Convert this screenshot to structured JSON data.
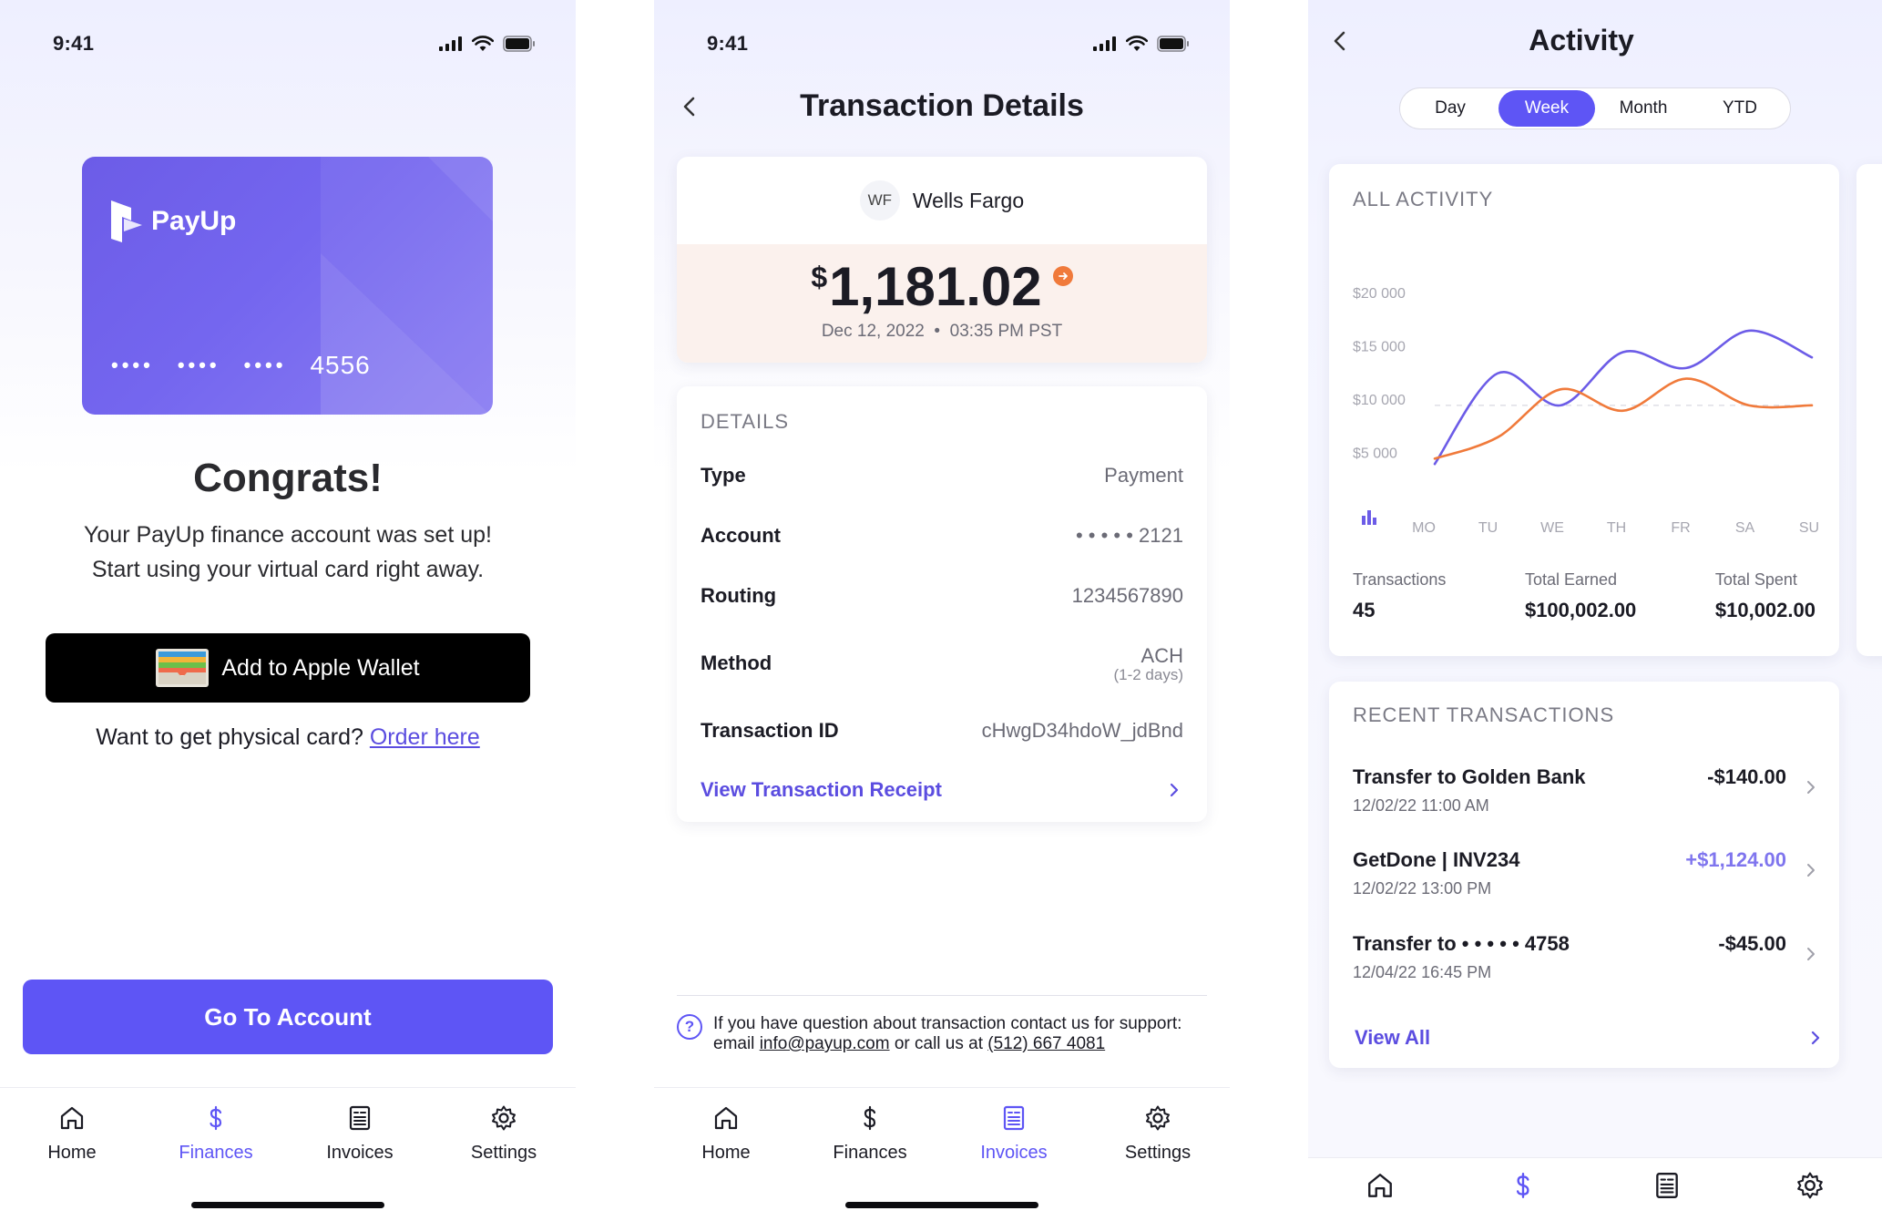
{
  "status_bar": {
    "time": "9:41"
  },
  "tabs": {
    "home": "Home",
    "finances": "Finances",
    "invoices": "Invoices",
    "settings": "Settings"
  },
  "screen1": {
    "card": {
      "brand": "PayUp",
      "masked_groups": [
        "••••",
        "••••",
        "••••"
      ],
      "last4": "4556"
    },
    "title": "Congrats!",
    "subtitle_line1": "Your PayUp finance account was set up!",
    "subtitle_line2": "Start using your virtual card right away.",
    "wallet_button": "Add to Apple Wallet",
    "physical_text": "Want to get physical card?",
    "physical_link": "Order here",
    "primary_button": "Go To Account",
    "active_tab": "finances"
  },
  "screen2": {
    "title": "Transaction Details",
    "merchant": {
      "initials": "WF",
      "name": "Wells Fargo"
    },
    "amount": {
      "currency": "$",
      "value": "1,181.02",
      "date": "Dec 12, 2022",
      "time": "03:35 PM PST"
    },
    "details_label": "DETAILS",
    "rows": [
      {
        "key": "Type",
        "value": "Payment"
      },
      {
        "key": "Account",
        "value": "• • • • • 2121"
      },
      {
        "key": "Routing",
        "value": "1234567890"
      },
      {
        "key": "Method",
        "value": "ACH",
        "sub": "(1-2 days)"
      },
      {
        "key": "Transaction ID",
        "value": "cHwgD34hdoW_jdBnd"
      }
    ],
    "receipt_link": "View Transaction Receipt",
    "support": {
      "text1": "If you have question about transaction contact us for support:",
      "email_prefix": "email",
      "email": "info@payup.com",
      "phone_prefix": "or call us at",
      "phone": "(512) 667 4081"
    },
    "active_tab": "invoices"
  },
  "screen3": {
    "title": "Activity",
    "segments": [
      "Day",
      "Week",
      "Month",
      "YTD"
    ],
    "active_segment": "Week",
    "activity_label": "ALL ACTIVITY",
    "stats": [
      {
        "label": "Transactions",
        "value": "45"
      },
      {
        "label": "Total Earned",
        "value": "$100,002.00"
      },
      {
        "label": "Total Spent",
        "value": "$10,002.00"
      }
    ],
    "recent_label": "RECENT TRANSACTIONS",
    "transactions": [
      {
        "name": "Transfer to Golden Bank",
        "date": "12/02/22  11:00 AM",
        "amount": "-$140.00",
        "positive": false
      },
      {
        "name": "GetDone | INV234",
        "date": "12/02/22  13:00 PM",
        "amount": "+$1,124.00",
        "positive": true
      },
      {
        "name": "Transfer to  • • • • • 4758",
        "date": "12/04/22  16:45 PM",
        "amount": "-$45.00",
        "positive": false
      }
    ],
    "view_all": "View All",
    "active_tab": "finances"
  },
  "chart_data": {
    "type": "line",
    "x": [
      "MO",
      "TU",
      "WE",
      "TH",
      "FR",
      "SA",
      "SU"
    ],
    "yticks": [
      "$20 000",
      "$15 000",
      "$10 000",
      "$5 000"
    ],
    "ylim": [
      0,
      20000
    ],
    "series": [
      {
        "color": "#6c5ce7",
        "values": [
          4000,
          12500,
          9500,
          14500,
          13000,
          16500,
          14000
        ]
      },
      {
        "color": "#f07a3b",
        "values": [
          4500,
          6500,
          11000,
          9000,
          12000,
          9500,
          9500
        ]
      }
    ],
    "reference": 9500,
    "grid": false
  },
  "colors": {
    "accent": "#5e55f5",
    "outflow": "#f07a3b",
    "amount_bg": "#fbf1ed"
  }
}
